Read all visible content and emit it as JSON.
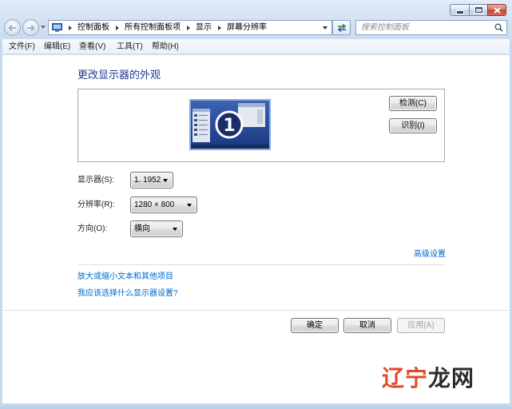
{
  "colors": {
    "link": "#0066cc",
    "title": "#1e3b8c",
    "close_button": "#c8463a",
    "selection": "#86acdf",
    "watermark_primary": "#e1492b"
  },
  "window_controls": {
    "minimize": "minimize-icon",
    "maximize": "maximize-icon",
    "close": "close-icon"
  },
  "nav": {
    "back": "back-arrow-icon",
    "forward": "forward-arrow-icon",
    "address_icon": "control-panel-icon",
    "breadcrumb": [
      "控制面板",
      "所有控制面板项",
      "显示",
      "屏幕分辨率"
    ],
    "refresh": "refresh-icon",
    "search_placeholder": "搜索控制面板",
    "search_icon": "search-icon"
  },
  "menu": [
    "文件(F)",
    "编辑(E)",
    "查看(V)",
    "工具(T)",
    "帮助(H)"
  ],
  "main": {
    "title": "更改显示器的外观",
    "monitor_number": "1",
    "detect_button": "检测(C)",
    "identify_button": "识别(I)",
    "fields": [
      {
        "label": "显示器(S):",
        "value": "1. 1952"
      },
      {
        "label": "分辨率(R):",
        "value": "1280 × 800"
      },
      {
        "label": "方向(O):",
        "value": "横向"
      }
    ],
    "advanced_link": "高级设置",
    "links": [
      "放大或缩小文本和其他项目",
      "我应该选择什么显示器设置?"
    ]
  },
  "footer": {
    "ok": "确定",
    "cancel": "取消",
    "apply": "应用(A)",
    "apply_enabled": false
  },
  "watermark": "辽宁龙网"
}
